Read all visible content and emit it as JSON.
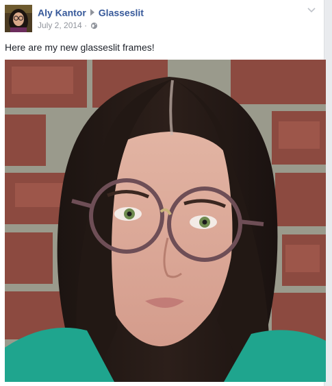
{
  "post": {
    "author": "Aly Kantor",
    "target_page": "Glasseslit",
    "date": "July 2, 2014",
    "separator": "·",
    "privacy_icon": "globe-icon",
    "menu_icon": "chevron-down-icon",
    "text": "Here are my new glasseslit frames!",
    "photo_subject": "selfie-woman-round-glasses-brick-wall"
  },
  "colors": {
    "link": "#365899",
    "meta": "#90949c",
    "text": "#1d2129",
    "shirt": "#1fa58e",
    "brick": "#8a4a40"
  }
}
